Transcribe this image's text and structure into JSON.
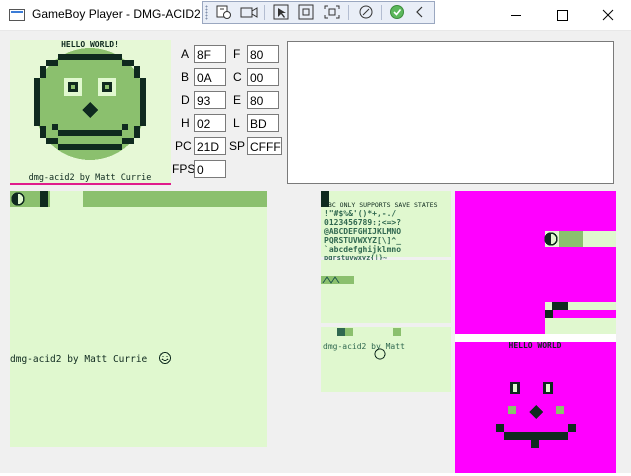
{
  "window": {
    "title": "GameBoy Player - DMG-ACID2",
    "toolbar_icons": [
      "settings-icon",
      "record-icon",
      "cursor-icon",
      "stop-icon",
      "screenshot-icon",
      "disk-icon",
      "checkmark-icon",
      "chevron-left-icon"
    ],
    "controls": [
      "minimize-icon",
      "maximize-icon",
      "close-icon"
    ]
  },
  "screen": {
    "banner": "HELLO WORLD!",
    "caption": "dmg-acid2 by Matt Currie"
  },
  "registers": {
    "A": {
      "label": "A",
      "value": "8F"
    },
    "F": {
      "label": "F",
      "value": "80"
    },
    "B": {
      "label": "B",
      "value": "0A"
    },
    "C": {
      "label": "C",
      "value": "00"
    },
    "D": {
      "label": "D",
      "value": "93"
    },
    "E": {
      "label": "E",
      "value": "80"
    },
    "H": {
      "label": "H",
      "value": "02"
    },
    "L": {
      "label": "L",
      "value": "BD"
    },
    "PC": {
      "label": "PC",
      "value": "21D"
    },
    "SP": {
      "label": "SP",
      "value": "CFFF"
    },
    "FPS": {
      "label": "FPS",
      "value": "0"
    }
  },
  "bgmap": {
    "caption": "dmg-acid2 by Matt Currie"
  },
  "tiles": {
    "line1": "GBC ONLY SUPPORTS SAVE STATES",
    "line2": "!\"#$%&'()*+,-./",
    "line3": "0123456789:;<=>?",
    "line4": "@ABCDEFGHIJKLMNO",
    "line5": "PQRSTUVWXYZ[\\]^_",
    "line6": "`abcdefghijklmno",
    "line7": "pqrstuvwxyz{|}~",
    "glitch": "dmg-acid2 by Matt"
  },
  "oam": {
    "banner": "HELLO WORLD"
  },
  "colors": {
    "gb_lightest": "#e0f8cf",
    "gb_light": "#8bc06e",
    "gb_dark": "#306850",
    "gb_darkest": "#0f2a1f",
    "magenta": "#ff00ff"
  }
}
